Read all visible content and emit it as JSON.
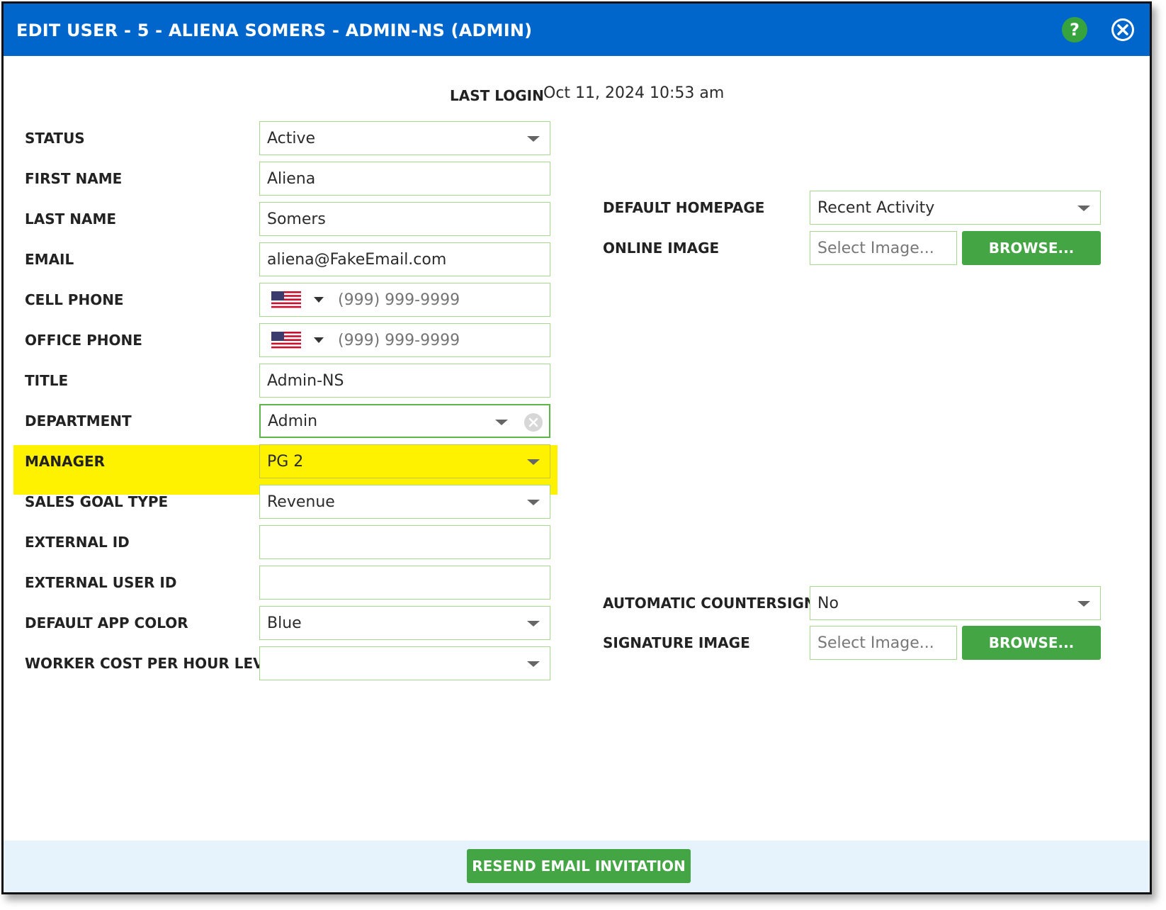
{
  "dialog": {
    "title": "EDIT USER - 5 - ALIENA SOMERS - ADMIN-NS (ADMIN)",
    "help_label": "?",
    "header_color": "#0066cc"
  },
  "last_login": {
    "label": "LAST LOGIN",
    "value": "Oct 11, 2024 10:53 am"
  },
  "form": {
    "status": {
      "label": "STATUS",
      "value": "Active"
    },
    "first_name": {
      "label": "FIRST NAME",
      "value": "Aliena"
    },
    "last_name": {
      "label": "LAST NAME",
      "value": "Somers"
    },
    "email": {
      "label": "EMAIL",
      "value": "aliena@FakeEmail.com"
    },
    "cell_phone": {
      "label": "CELL PHONE",
      "placeholder": "(999) 999-9999",
      "country_icon": "us-flag-icon"
    },
    "office_phone": {
      "label": "OFFICE PHONE",
      "placeholder": "(999) 999-9999",
      "country_icon": "us-flag-icon"
    },
    "title": {
      "label": "TITLE",
      "value": "Admin-NS"
    },
    "department": {
      "label": "DEPARTMENT",
      "value": "Admin"
    },
    "manager": {
      "label": "MANAGER",
      "value": "PG 2",
      "highlight_color": "#fff200"
    },
    "sales_goal_type": {
      "label": "SALES GOAL TYPE",
      "value": "Revenue"
    },
    "external_id": {
      "label": "EXTERNAL ID",
      "value": ""
    },
    "external_user_id": {
      "label": "EXTERNAL USER ID",
      "value": ""
    },
    "default_app_color": {
      "label": "DEFAULT APP COLOR",
      "value": "Blue"
    },
    "worker_cost": {
      "label": "WORKER COST PER HOUR LEVEL",
      "value": ""
    }
  },
  "right": {
    "default_homepage": {
      "label": "DEFAULT HOMEPAGE",
      "value": "Recent Activity"
    },
    "online_image": {
      "label": "ONLINE IMAGE",
      "placeholder": "Select Image...",
      "button": "BROWSE..."
    },
    "automatic_countersign": {
      "label": "AUTOMATIC COUNTERSIGN",
      "value": "No"
    },
    "signature_image": {
      "label": "SIGNATURE IMAGE",
      "placeholder": "Select Image...",
      "button": "BROWSE..."
    }
  },
  "footer": {
    "resend_label": "RESEND EMAIL INVITATION"
  },
  "colors": {
    "button_green": "#44a545",
    "field_border": "#a7d98d",
    "footer_bg": "#e6f2fc"
  }
}
